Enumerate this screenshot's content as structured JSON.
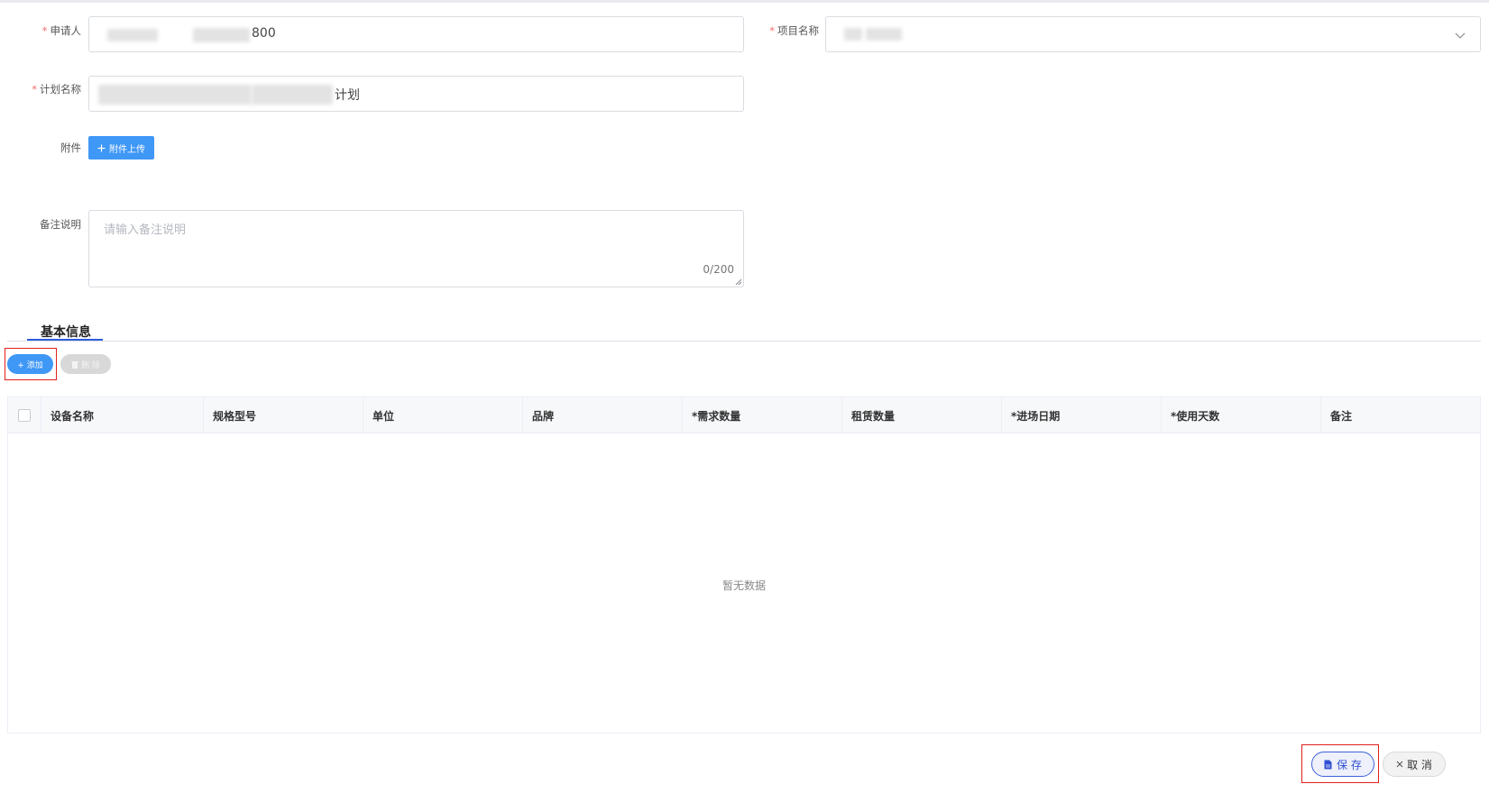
{
  "form": {
    "applicant": {
      "label": "申请人",
      "required": true,
      "value_suffix": "800"
    },
    "project": {
      "label": "项目名称",
      "required": true
    },
    "plan_name": {
      "label": "计划名称",
      "required": true,
      "value_suffix": "计划"
    },
    "attachment": {
      "label": "附件",
      "upload_button": "附件上传",
      "upload_icon": "plus-icon"
    },
    "remark": {
      "label": "备注说明",
      "placeholder": "请输入备注说明",
      "counter": "0/200"
    }
  },
  "section": {
    "title": "基本信息"
  },
  "toolbar": {
    "add_label": "+ 添加",
    "delete_label": "删 除",
    "delete_icon": "trash-icon"
  },
  "table": {
    "columns": [
      "设备名称",
      "规格型号",
      "单位",
      "品牌",
      "*需求数量",
      "租赁数量",
      "*进场日期",
      "*使用天数",
      "备注"
    ],
    "empty_text": "暂无数据"
  },
  "footer": {
    "save_label": "保 存",
    "cancel_label": "取 消",
    "save_icon": "document-icon",
    "cancel_icon": "close-icon"
  },
  "colors": {
    "primary": "#3f97f6",
    "required": "#f56c6c",
    "highlight": "#e0201c",
    "save_border": "#3f5fd8"
  }
}
